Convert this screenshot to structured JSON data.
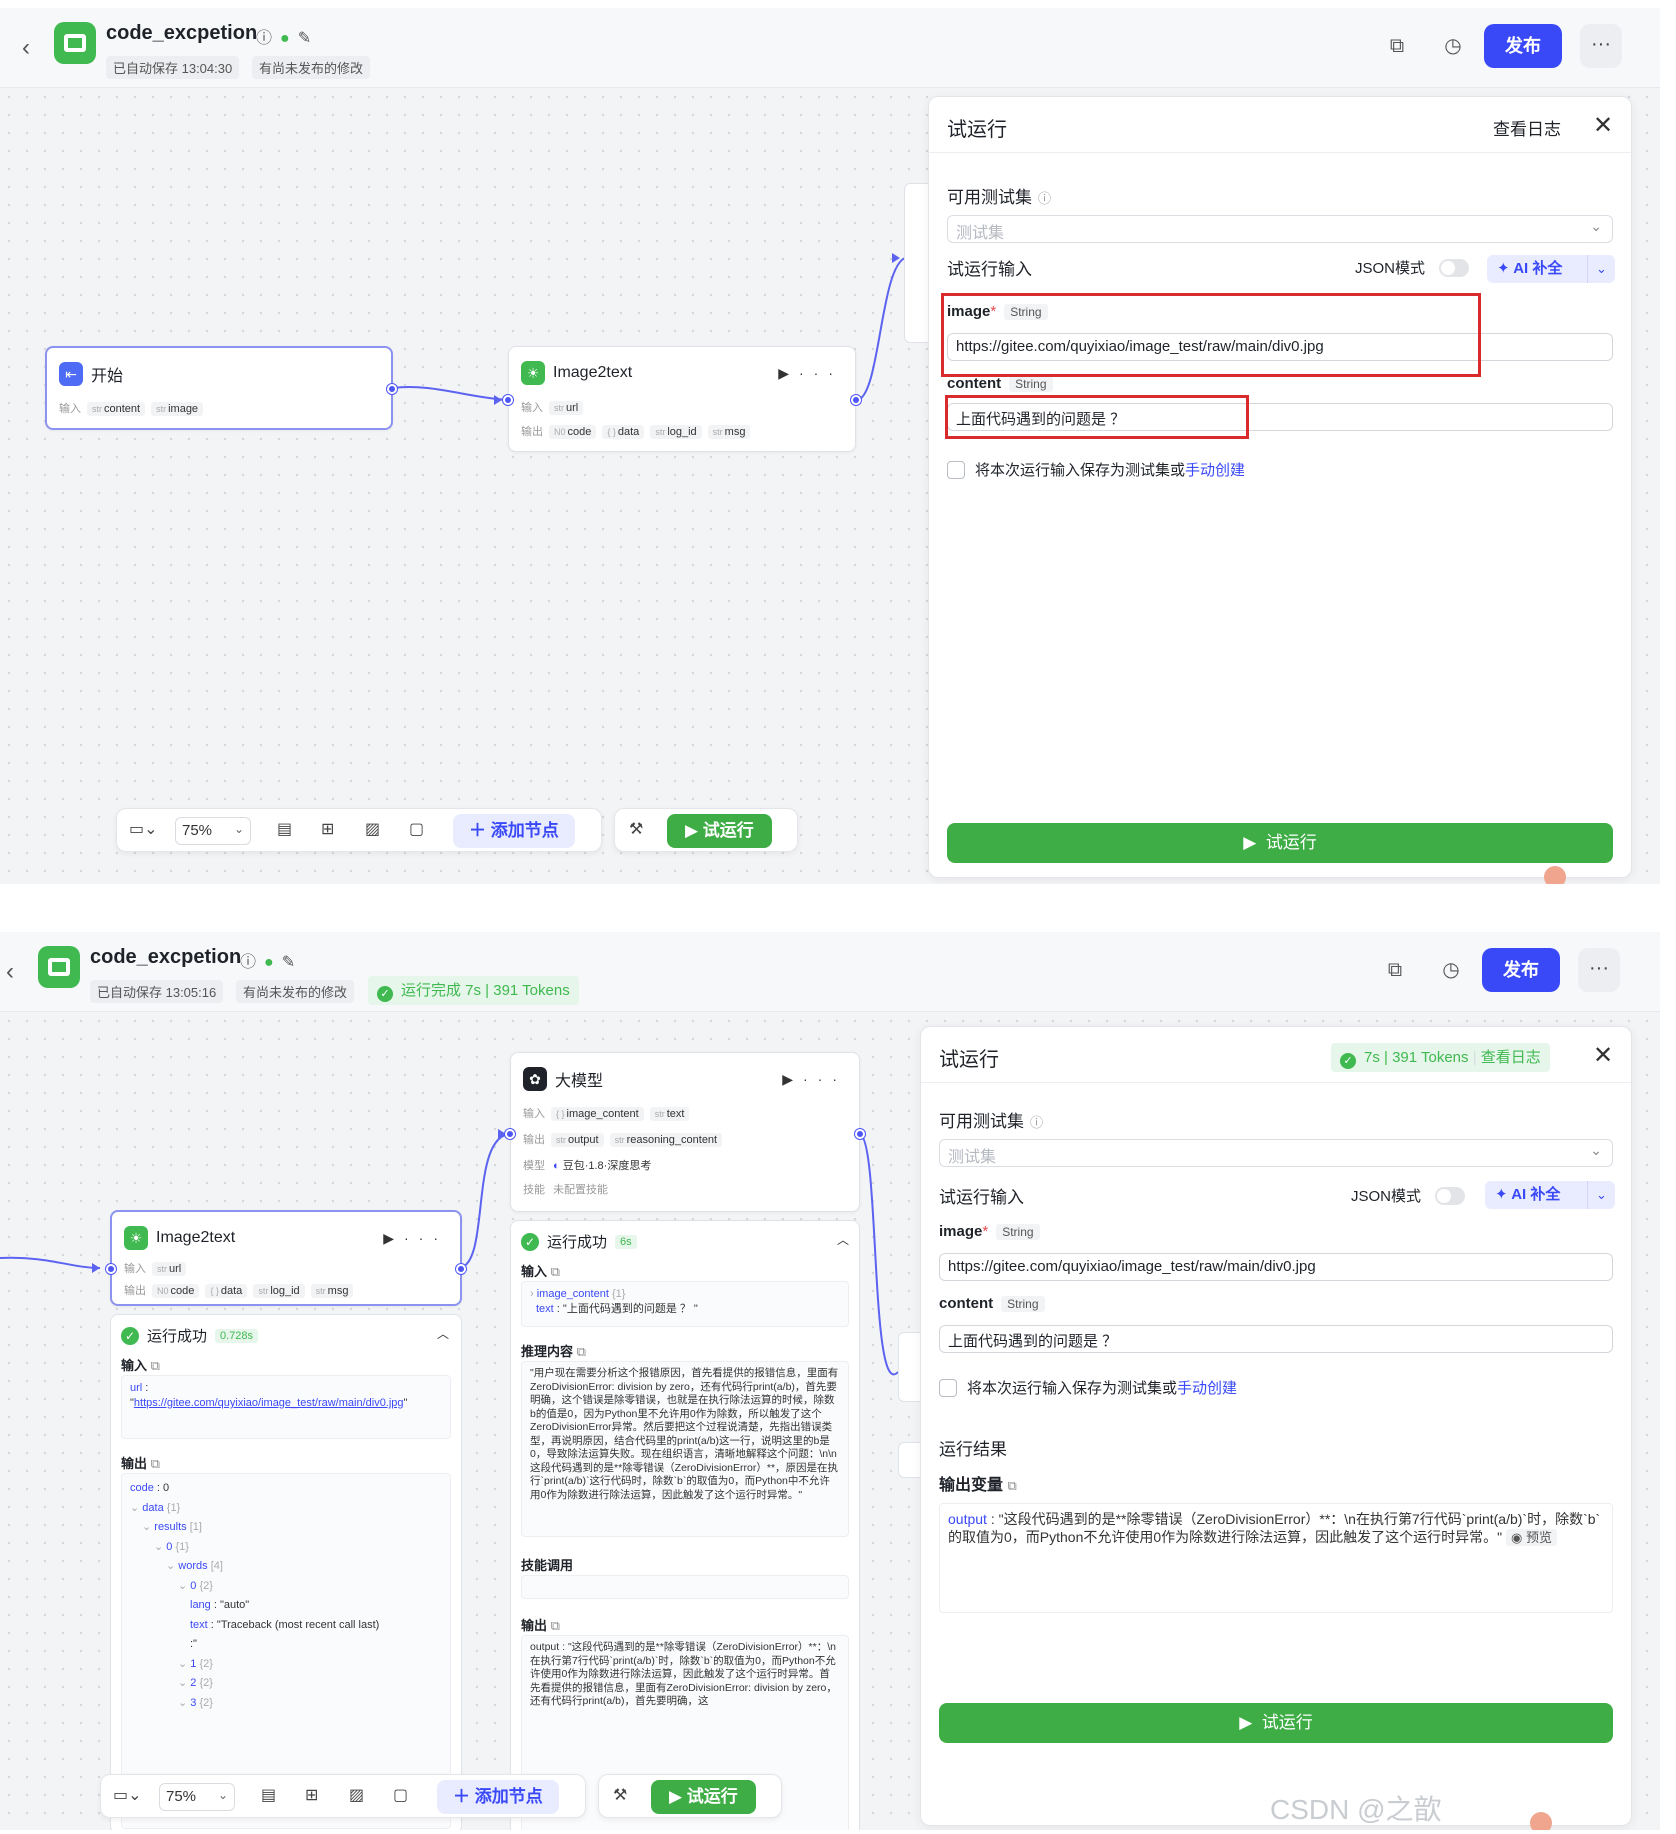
{
  "app": {
    "name": "code_excpetion",
    "unpublished": "有尚未发布的修改",
    "publish": "发布"
  },
  "s1": {
    "autosave": "已自动保存 13:04:30",
    "zoom": "75%",
    "add_node": "添加节点",
    "test_run": "试运行"
  },
  "s2": {
    "autosave": "已自动保存 13:05:16",
    "run_done": "运行完成 7s | 391 Tokens",
    "zoom": "75%",
    "add_node": "添加节点",
    "test_run": "试运行"
  },
  "nodes": {
    "start": {
      "title": "开始",
      "in_label": "输入",
      "params": [
        "content",
        "image"
      ]
    },
    "image2text": {
      "title": "Image2text",
      "in_label": "输入",
      "out_label": "输出",
      "inputs": [
        "url"
      ],
      "outputs": [
        "code",
        "data",
        "log_id",
        "msg"
      ]
    },
    "llm": {
      "title": "大模型",
      "in_label": "输入",
      "out_label": "输出",
      "model_label": "模型",
      "skill_label": "技能",
      "inputs": [
        "image_content",
        "text"
      ],
      "outputs": [
        "output",
        "reasoning_content"
      ],
      "model": "豆包·1.8·深度思考",
      "skill": "未配置技能"
    }
  },
  "types": {
    "str": "str",
    "num": "N0",
    "obj": "{ }"
  },
  "panel": {
    "title": "试运行",
    "view_log": "查看日志",
    "close": "✕",
    "testset_label": "可用测试集",
    "testset_placeholder": "测试集",
    "input_label": "试运行输入",
    "json_mode": "JSON模式",
    "ai_fill": "AI 补全",
    "image_label": "image",
    "image_required": "*",
    "image_type": "String",
    "image_value": "https://gitee.com/quyixiao/image_test/raw/main/div0.jpg",
    "content_label": "content",
    "content_type": "String",
    "content_value": "上面代码遇到的问题是 ？",
    "save_text": "将本次运行输入保存为测试集或",
    "manual_create": "手动创建",
    "run": "试运行",
    "stats": "7s | 391 Tokens",
    "result_label": "运行结果",
    "out_var_label": "输出变量",
    "output_key": "output",
    "output_value": "\"这段代码遇到的是**除零错误（ZeroDivisionError）**：\\n在执行第7行代码`print(a/b)`时，除数`b`的取值为0，而Python不允许使用0作为除数进行除法运算，因此触发了这个运行时异常。\"",
    "preview": "预览"
  },
  "result_img": {
    "status": "运行成功",
    "time": "0.728s",
    "input_label": "输入",
    "url_key": "url",
    "url_value": "https://gitee.com/quyixiao/image_test/raw/main/div0.jpg",
    "output_label": "输出",
    "tree": [
      {
        "indent": 0,
        "k": "code",
        "v": ": 0"
      },
      {
        "indent": 0,
        "k": "data",
        "v": "{1}",
        "c": true
      },
      {
        "indent": 1,
        "k": "results",
        "v": "[1]",
        "c": true
      },
      {
        "indent": 2,
        "k": "0",
        "v": "{1}",
        "c": true
      },
      {
        "indent": 3,
        "k": "words",
        "v": "[4]",
        "c": true
      },
      {
        "indent": 4,
        "k": "0",
        "v": "{2}",
        "c": true
      },
      {
        "indent": 5,
        "k": "lang",
        "v": ": \"auto\""
      },
      {
        "indent": 5,
        "k": "text",
        "v": ": \"Traceback (most recent call last)"
      },
      {
        "indent": 5,
        "k": "",
        "v": ":\""
      },
      {
        "indent": 4,
        "k": "1",
        "v": "{2}",
        "c": true
      },
      {
        "indent": 4,
        "k": "2",
        "v": "{2}",
        "c": true
      },
      {
        "indent": 4,
        "k": "3",
        "v": "{2}",
        "c": true
      }
    ]
  },
  "result_llm": {
    "status": "运行成功",
    "time": "6s",
    "input_label": "输入",
    "image_content_key": "image_content",
    "image_content_count": "{1}",
    "text_key": "text",
    "text_value": ": \"上面代码遇到的问题是 ？ \"",
    "reason_label": "推理内容",
    "reason_text": "\"用户现在需要分析这个报错原因，首先看提供的报错信息，里面有ZeroDivisionError: division by zero，还有代码行print(a/b)，首先要明确，这个错误是除零错误，也就是在执行除法运算的时候，除数b的值是0，因为Python里不允许用0作为除数，所以触发了这个ZeroDivisionError异常。然后要把这个过程说清楚，先指出错误类型，再说明原因，结合代码里的print(a/b)这一行，说明这里的b是0，导致除法运算失败。现在组织语言，清晰地解释这个问题：\\n\\n这段代码遇到的是**除零错误（ZeroDivisionError）**，原因是在执行`print(a/b)`这行代码时，除数`b`的取值为0，而Python中不允许用0作为除数进行除法运算，因此触发了这个运行时异常。\"",
    "skill_label": "技能调用",
    "output_label": "输出",
    "output_text": "output : \"这段代码遇到的是**除零错误（ZeroDivisionError）**：\\n在执行第7行代码`print(a/b)`时，除数`b`的取值为0，而Python不允许使用0作为除数进行除法运算，因此触发了这个运行时异常。首先看提供的报错信息，里面有ZeroDivisionError: division by zero，还有代码行print(a/b)，首先要明确，这"
  },
  "watermark": "CSDN @之歆"
}
